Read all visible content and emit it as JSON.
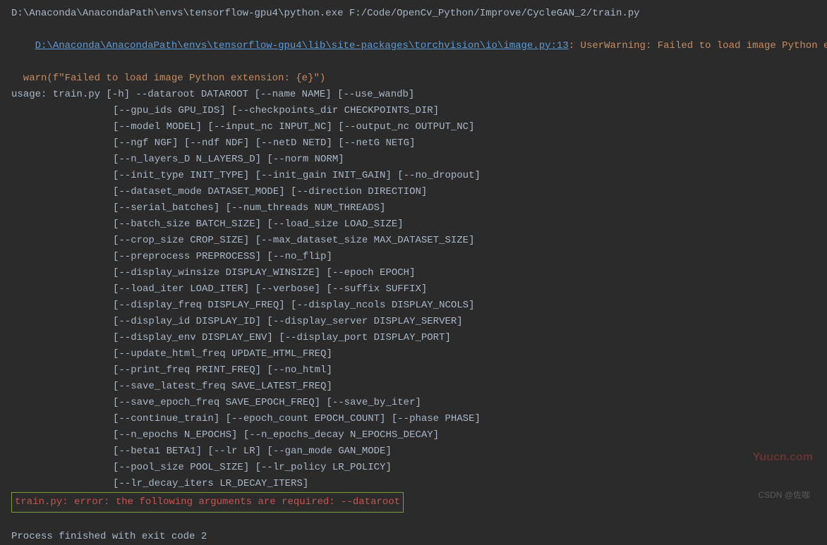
{
  "command_line": "D:\\Anaconda\\AnacondaPath\\envs\\tensorflow-gpu4\\python.exe F:/Code/OpenCv_Python/Improve/CycleGAN_2/train.py",
  "file_path_link": "D:\\Anaconda\\AnacondaPath\\envs\\tensorflow-gpu4\\lib\\site-packages\\torchvision\\io\\image.py:13",
  "user_warning": ": UserWarning: Failed to load image Python extension:",
  "warn_line": "  warn(f\"Failed to load image Python extension: {e}\")",
  "usage_header": "usage: train.py [-h] --dataroot DATAROOT [--name NAME] [--use_wandb]",
  "usage_lines": [
    "[--gpu_ids GPU_IDS] [--checkpoints_dir CHECKPOINTS_DIR]",
    "[--model MODEL] [--input_nc INPUT_NC] [--output_nc OUTPUT_NC]",
    "[--ngf NGF] [--ndf NDF] [--netD NETD] [--netG NETG]",
    "[--n_layers_D N_LAYERS_D] [--norm NORM]",
    "[--init_type INIT_TYPE] [--init_gain INIT_GAIN] [--no_dropout]",
    "[--dataset_mode DATASET_MODE] [--direction DIRECTION]",
    "[--serial_batches] [--num_threads NUM_THREADS]",
    "[--batch_size BATCH_SIZE] [--load_size LOAD_SIZE]",
    "[--crop_size CROP_SIZE] [--max_dataset_size MAX_DATASET_SIZE]",
    "[--preprocess PREPROCESS] [--no_flip]",
    "[--display_winsize DISPLAY_WINSIZE] [--epoch EPOCH]",
    "[--load_iter LOAD_ITER] [--verbose] [--suffix SUFFIX]",
    "[--display_freq DISPLAY_FREQ] [--display_ncols DISPLAY_NCOLS]",
    "[--display_id DISPLAY_ID] [--display_server DISPLAY_SERVER]",
    "[--display_env DISPLAY_ENV] [--display_port DISPLAY_PORT]",
    "[--update_html_freq UPDATE_HTML_FREQ]",
    "[--print_freq PRINT_FREQ] [--no_html]",
    "[--save_latest_freq SAVE_LATEST_FREQ]",
    "[--save_epoch_freq SAVE_EPOCH_FREQ] [--save_by_iter]",
    "[--continue_train] [--epoch_count EPOCH_COUNT] [--phase PHASE]",
    "[--n_epochs N_EPOCHS] [--n_epochs_decay N_EPOCHS_DECAY]",
    "[--beta1 BETA1] [--lr LR] [--gan_mode GAN_MODE]",
    "[--pool_size POOL_SIZE] [--lr_policy LR_POLICY]",
    "[--lr_decay_iters LR_DECAY_ITERS]"
  ],
  "error_message": "train.py: error: the following arguments are required: --dataroot",
  "process_finished": "Process finished with exit code 2",
  "watermark_right": "Yuucn.com",
  "watermark_bottom": "CSDN @佐咖"
}
